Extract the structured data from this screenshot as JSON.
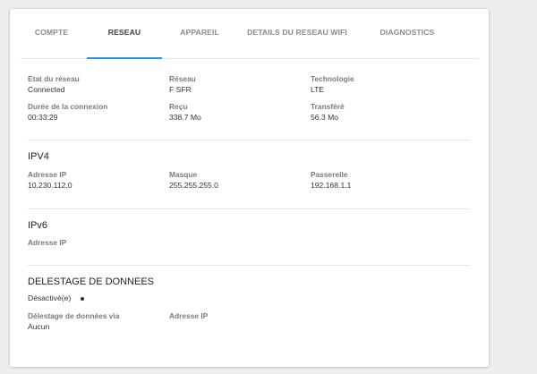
{
  "tabs": [
    "COMPTE",
    "RESEAU",
    "APPAREIL",
    "DETAILS DU RESEAU WIFI",
    "DIAGNOSTICS"
  ],
  "active_tab": "RESEAU",
  "network": {
    "etat_label": "Etat du réseau",
    "etat_value": "Connected",
    "reseau_label": "Réseau",
    "reseau_value": "F SFR",
    "technologie_label": "Technologie",
    "technologie_value": "LTE",
    "duree_label": "Durée de la connexion",
    "duree_value": "00:33:29",
    "recu_label": "Reçu",
    "recu_value": "338.7 Mo",
    "transfere_label": "Transféré",
    "transfere_value": "56.3 Mo"
  },
  "ipv4": {
    "title": "IPV4",
    "adresse_label": "Adresse IP",
    "adresse_value": "10.230.112.0",
    "masque_label": "Masque",
    "masque_value": "255.255.255.0",
    "passerelle_label": "Passerelle",
    "passerelle_value": "192.168.1.1"
  },
  "ipv6": {
    "title": "IPv6",
    "adresse_label": "Adresse IP"
  },
  "delestage": {
    "title": "DELESTAGE DE DONNEES",
    "status": "Désactivé(e)",
    "via_label": "Délestage de données via",
    "via_value": "Aucun",
    "adresse_label": "Adresse IP"
  }
}
